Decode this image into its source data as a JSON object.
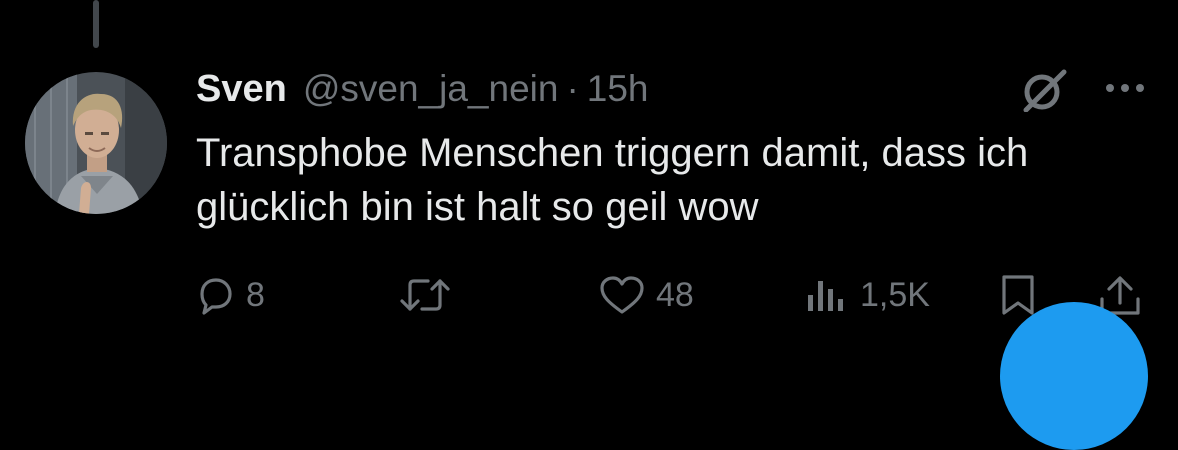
{
  "tweet": {
    "author_name": "Sven",
    "author_handle": "@sven_ja_nein",
    "separator": "·",
    "time": "15h",
    "text": "Transphobe Menschen triggern damit, dass ich glücklich bin ist halt so geil wow"
  },
  "icons": {
    "header": [
      "grok-icon",
      "more-icon"
    ],
    "actions": [
      "reply-icon",
      "retweet-icon",
      "like-icon",
      "views-icon",
      "bookmark-icon",
      "share-icon"
    ]
  },
  "actions": {
    "reply_count": "8",
    "retweet_count": "",
    "like_count": "48",
    "view_count": "1,5K"
  },
  "colors": {
    "background": "#000000",
    "primary_text": "#e7e9ea",
    "secondary_text": "#71767b",
    "accent": "#1d9bf0",
    "thread_line": "#42474c"
  }
}
